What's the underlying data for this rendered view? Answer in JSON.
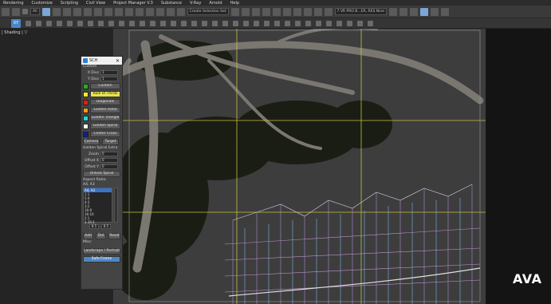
{
  "menubar": {
    "items": [
      "Rendering",
      "Customize",
      "Scripting",
      "Civil View",
      "Project Manager V.3",
      "Substance",
      "V-Ray",
      "Arnold",
      "Help"
    ]
  },
  "toolbar": {
    "filter_dropdown": "All",
    "selection_set_dropdown": "Create Selection Set",
    "search_dropdown": "7 VR PRO B...ER, RES Nine",
    "xy_label": "XY"
  },
  "viewport": {
    "label": "| Shading | ▽"
  },
  "brand": "AVA",
  "panel": {
    "title": "SCH",
    "close_glyph": "✕",
    "custom_label": "Custom",
    "x_divs_label": "X Divs",
    "x_divs_value": "1",
    "y_divs_label": "Y Divs",
    "y_divs_value": "1",
    "colors": {
      "green": "#18b41e",
      "yellow": "#f2ee1c",
      "red": "#e21f16",
      "orange": "#f39a12",
      "cyan": "#19d9d7",
      "white": "#ffffff",
      "navy": "#0b1f9c"
    },
    "guides": [
      {
        "label": "Custom",
        "color": "green",
        "active": false
      },
      {
        "label": "Rule of Thirds",
        "color": "yellow",
        "active": true
      },
      {
        "label": "Diagonals",
        "color": "red",
        "active": false
      },
      {
        "label": "Golden Ratio",
        "color": "orange",
        "active": false
      },
      {
        "label": "Golden Triangle",
        "color": "cyan",
        "active": false
      },
      {
        "label": "Golden Spiral",
        "color": "white",
        "active": false
      },
      {
        "label": "Center Cross",
        "color": "navy",
        "active": false
      }
    ],
    "camera_button": "Camera",
    "target_button": "Target",
    "spiral_label": "Golden Spiral Extra",
    "zoom_label": "Zoom",
    "zoom_value": "0",
    "offset_x_label": "Offset X",
    "offset_x_value": "0",
    "offset_y_label": "Offset Y",
    "offset_y_value": "0",
    "unlock_spiral_button": "Unlock Spiral",
    "aspect_label": "Aspect Ratio:",
    "aspect_current": "A4, A3",
    "aspect_list": [
      "A4, A3",
      "1:1",
      "5:4",
      "4:3",
      "3:2",
      "16:9",
      "16:10",
      "2:1",
      "2.35:1"
    ],
    "ratio_a": "8.5",
    "ratio_b": "8.5",
    "add_button": "Add",
    "del_button": "Del",
    "reset_button": "Reset",
    "misc_label": "Misc:",
    "landscape_button": "Landscape / Portrait",
    "safe_frame_button": "Safe Frame"
  }
}
